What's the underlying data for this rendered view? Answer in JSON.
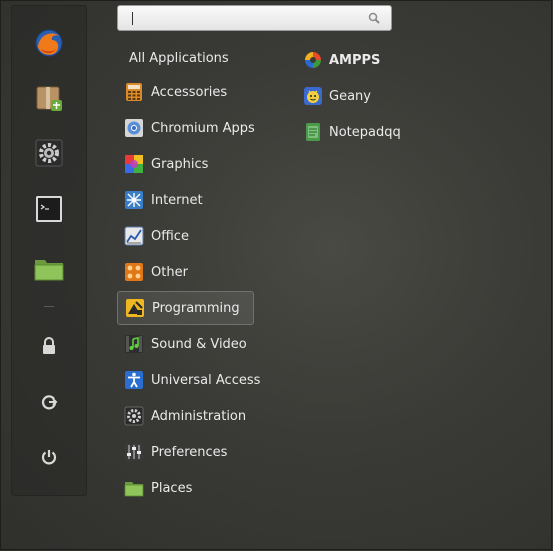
{
  "search": {
    "value": "",
    "placeholder": ""
  },
  "all_applications_label": "All Applications",
  "categories": [
    {
      "label": "Accessories",
      "icon": "calculator-icon"
    },
    {
      "label": "Chromium Apps",
      "icon": "chromium-icon"
    },
    {
      "label": "Graphics",
      "icon": "color-palette-icon"
    },
    {
      "label": "Internet",
      "icon": "network-icon"
    },
    {
      "label": "Office",
      "icon": "chart-icon"
    },
    {
      "label": "Other",
      "icon": "other-grid-icon"
    },
    {
      "label": "Programming",
      "icon": "programming-tools-icon",
      "selected": true
    },
    {
      "label": "Sound & Video",
      "icon": "music-icon"
    },
    {
      "label": "Universal Access",
      "icon": "accessibility-icon"
    },
    {
      "label": "Administration",
      "icon": "admin-gear-icon"
    },
    {
      "label": "Preferences",
      "icon": "sliders-icon"
    },
    {
      "label": "Places",
      "icon": "folder-icon"
    }
  ],
  "apps": [
    {
      "label": "AMPPS",
      "icon": "ampps-icon"
    },
    {
      "label": "Geany",
      "icon": "geany-icon"
    },
    {
      "label": "Notepadqq",
      "icon": "notepadqq-icon"
    }
  ],
  "favorites": [
    {
      "name": "firefox-icon"
    },
    {
      "name": "package-manager-icon"
    },
    {
      "name": "system-settings-icon"
    },
    {
      "name": "terminal-icon"
    },
    {
      "name": "files-folder-icon"
    }
  ],
  "system_buttons": [
    {
      "name": "lock-icon"
    },
    {
      "name": "logout-icon"
    },
    {
      "name": "power-icon"
    }
  ]
}
